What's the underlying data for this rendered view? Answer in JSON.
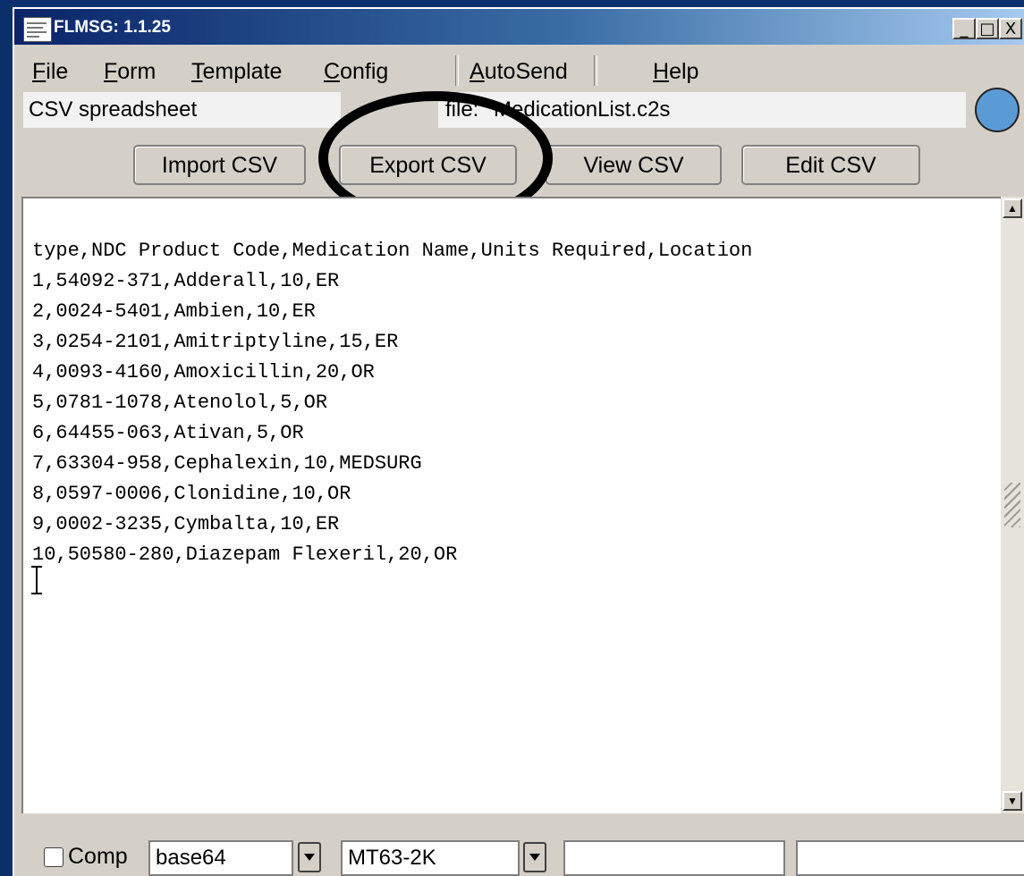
{
  "window": {
    "title": "FLMSG: 1.1.25"
  },
  "titlebar_buttons": {
    "minimize": "_",
    "maximize": "□",
    "close": "X"
  },
  "menu": {
    "file": "File",
    "form": "Form",
    "template": "Template",
    "config": "Config",
    "autosend": "AutoSend",
    "help": "Help"
  },
  "status": {
    "form_name": "CSV spreadsheet",
    "file_prefix": "file:",
    "file_name": "MedicationList.c2s",
    "indicator_color": "#5b9bd5"
  },
  "toolbar": {
    "import_csv": "Import CSV",
    "export_csv": "Export CSV",
    "view_csv": "View CSV",
    "edit_csv": "Edit CSV"
  },
  "editor": {
    "lines": [
      "type,NDC Product Code,Medication Name,Units Required,Location",
      "1,54092-371,Adderall,10,ER",
      "2,0024-5401,Ambien,10,ER",
      "3,0254-2101,Amitriptyline,15,ER",
      "4,0093-4160,Amoxicillin,20,OR",
      "5,0781-1078,Atenolol,5,OR",
      "6,64455-063,Ativan,5,OR",
      "7,63304-958,Cephalexin,10,MEDSURG",
      "8,0597-0006,Clonidine,10,OR",
      "9,0002-3235,Cymbalta,10,ER",
      "10,50580-280,Diazepam Flexeril,20,OR"
    ]
  },
  "bottom": {
    "comp_label": "Comp",
    "comp_checked": false,
    "encoding_value": "base64",
    "mode_value": "MT63-2K",
    "field1_value": "",
    "field2_value": ""
  }
}
